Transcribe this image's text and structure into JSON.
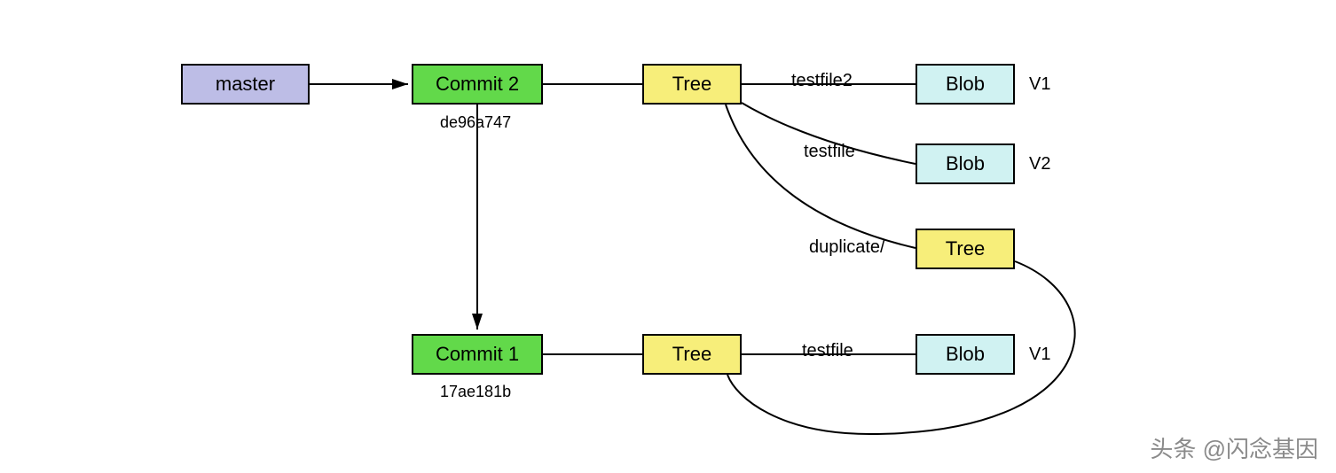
{
  "nodes": {
    "master": {
      "label": "master",
      "type": "branch"
    },
    "commit2": {
      "label": "Commit 2",
      "hash": "de96a747"
    },
    "commit1": {
      "label": "Commit 1",
      "hash": "17ae181b"
    },
    "tree_top": {
      "label": "Tree"
    },
    "tree_dup": {
      "label": "Tree"
    },
    "tree_bottom": {
      "label": "Tree"
    },
    "blob_v1_top": {
      "label": "Blob",
      "version": "V1"
    },
    "blob_v2": {
      "label": "Blob",
      "version": "V2"
    },
    "blob_v1_bottom": {
      "label": "Blob",
      "version": "V1"
    }
  },
  "edges": {
    "e1": "testfile2",
    "e2": "testfile",
    "e3": "duplicate/",
    "e4": "testfile"
  },
  "watermark": "头条 @闪念基因"
}
